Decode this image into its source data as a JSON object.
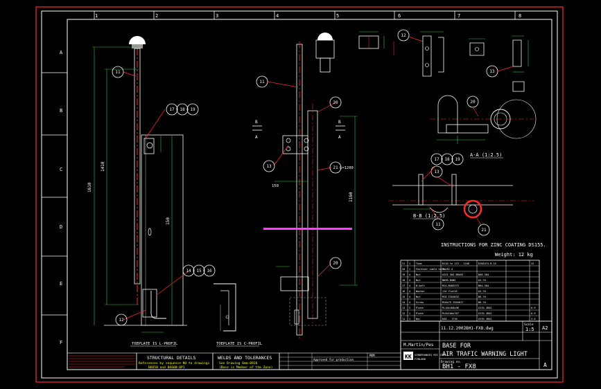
{
  "colors": {
    "background": "#000000",
    "frame": "#ffffff",
    "red": "#ff2a2a",
    "green": "#2ecc40",
    "magenta": "#ff3cff",
    "yellow": "#ffff00",
    "cyan": "#00ffff",
    "grey": "#9a9a9a"
  },
  "grid": {
    "top_numbers": [
      "1",
      "2",
      "3",
      "4",
      "5",
      "6",
      "7",
      "8"
    ],
    "side_letters": [
      "A",
      "B",
      "C",
      "D",
      "E",
      "F"
    ]
  },
  "callouts": {
    "c11a": "11",
    "c11b": "11",
    "c12a": "12",
    "c12b": "12",
    "c13a": "13",
    "c13b": "13",
    "c13c": "13",
    "c14": "14",
    "c15": "15",
    "c16": "16",
    "c17a": "17",
    "c18a": "18",
    "c19a": "19",
    "c17b": "17",
    "c18b": "18",
    "c19b": "19",
    "c20a": "20",
    "c20b": "20",
    "c20c": "20",
    "c21a": "21",
    "c21b": "21",
    "c11c": "11"
  },
  "labels": {
    "dim_left_long": "1610",
    "dim_left_mid": "1410",
    "dim_150": "150",
    "dim_l1200": "L=1200",
    "dim_150b": "150",
    "dim_1160": "1160",
    "section_aa": "A-A (1:2.5)",
    "section_bb": "B-B (1:2.5)",
    "instructions": "INSTRUCTIONS FOR ZINC COATING DS155.",
    "weight": "Weight:  12 kg",
    "toeplate_s": "TOEPLATE IS L-PROFIL",
    "toeplate_c": "TOEPLATE IS C-PROFIL",
    "sec_a": "A",
    "sec_b": "B"
  },
  "notes": {
    "structural_title": "STRUCTURAL DETAILS",
    "structural_line1": "References by sequence NO to drawings",
    "structural_line2": "B6650 and 06600-OP1",
    "welds_title": "WELDS AND TOLERANCES",
    "welds_line1": "See Drawing   6mm-0920",
    "welds_line2": "(Base is Member of the Zone)",
    "rev_text": "Approved for production",
    "rev_code": "MOM"
  },
  "parts_list": {
    "header": [
      "",
      "",
      "",
      "",
      "",
      ""
    ],
    "rows": [
      [
        "21",
        "1",
        "Tube",
        "D110 to 123 - 1100",
        "DIN2474-B-IX",
        "",
        "22"
      ],
      [
        "20",
        "1",
        "Fastener cable holder",
        "PL-52-4",
        "",
        "",
        ""
      ],
      [
        "19",
        "4",
        "Nut",
        "AISI 304 BRASS",
        "BA6.304",
        "",
        ""
      ],
      [
        "18",
        "4",
        "Nut",
        "NW30-BANS",
        "A2-70",
        "",
        ""
      ],
      [
        "17",
        "4",
        "B-bolt",
        "M14-M40X375",
        "B6a.304",
        "",
        ""
      ],
      [
        "16",
        "4",
        "Washer",
        "110 flat16",
        "A2-70",
        "",
        ""
      ],
      [
        "15",
        "4",
        "Nut",
        "M16 ISO4032",
        "B6-70",
        "",
        ""
      ],
      [
        "14",
        "4",
        "Screw",
        "M16x75 ISO4017",
        "B6-70",
        "",
        ""
      ],
      [
        "13",
        "2",
        "Plate",
        "PL16x160x98",
        "S235 JRG2",
        "",
        "0.9"
      ],
      [
        "12",
        "1",
        "Plate",
        "PL8x160x707",
        "S235 JRG2",
        "",
        "0.9"
      ],
      [
        "11",
        "1",
        "Bar",
        "D48 - 1710",
        "S235 JRG2",
        "",
        "3.0"
      ]
    ]
  },
  "title_block": {
    "date": "11.12.2002",
    "filename": "BH1-FX8.dwg",
    "scale": "1:5",
    "size": "A2",
    "author": "M.Martin/Pes",
    "title1": "BASE FOR",
    "title2": "AIR TRAFIC WARNING LIGHT",
    "drawing_label": "Drawing no.",
    "drawing_no": "BH1 - FX8",
    "revision": "A",
    "company1": "VINDERANAES MIC CORP",
    "company2": "FINLAND",
    "logo": "KK",
    "scale_label": "Scale"
  }
}
